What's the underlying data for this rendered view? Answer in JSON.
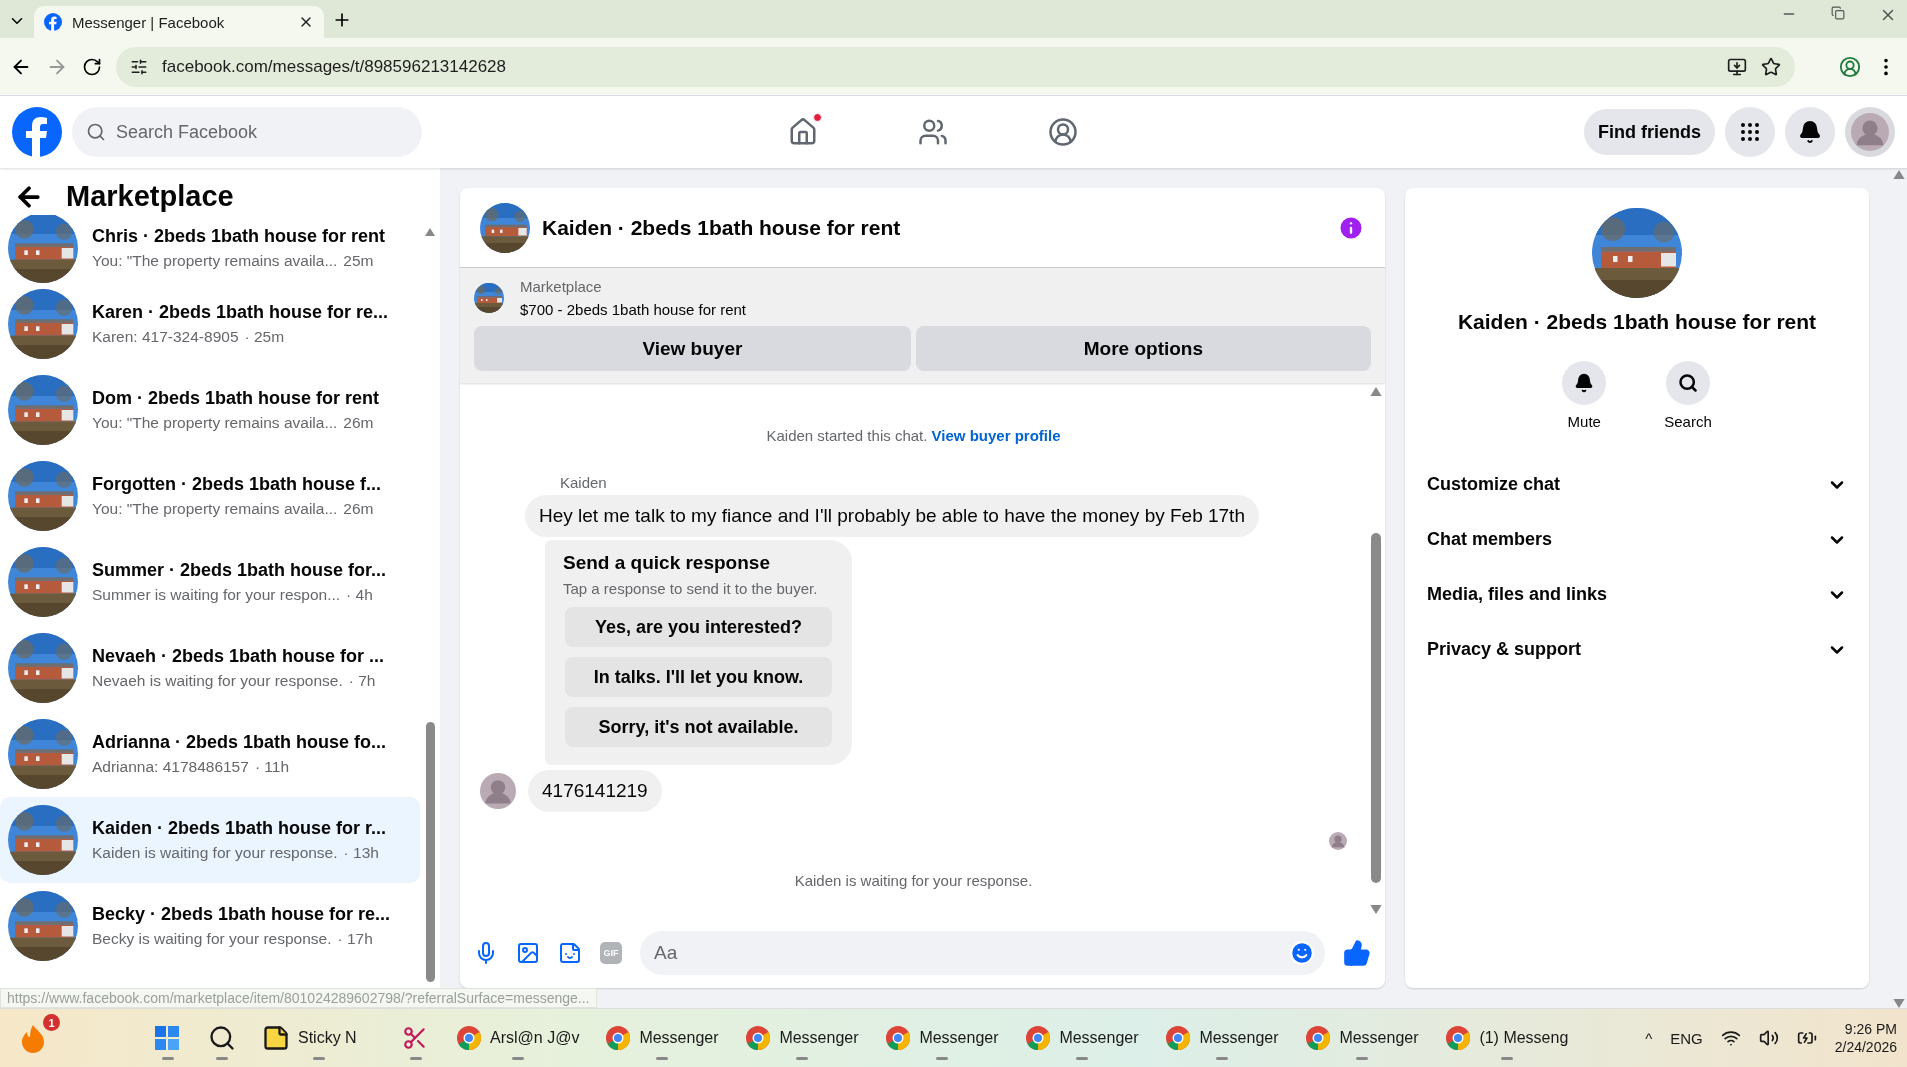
{
  "browser": {
    "tabs": [
      {
        "title": "Messenger | Facebook",
        "selected": true
      }
    ],
    "url": "facebook.com/messages/t/898596213142628"
  },
  "header": {
    "search_placeholder": "Search Facebook",
    "nav": [
      {
        "kind": "home",
        "notification": true
      },
      {
        "kind": "friends",
        "notification": false
      },
      {
        "kind": "groups",
        "notification": false
      }
    ],
    "find_friends": "Find friends"
  },
  "sidebar": {
    "title": "Marketplace",
    "conversations": [
      {
        "title": "Chris · 2beds 1bath house for rent",
        "preview": "You: \"The property remains availa...",
        "time": "25m",
        "selected": false
      },
      {
        "title": "Karen · 2beds 1bath house for re...",
        "preview": "Karen: 417-324-8905",
        "time": "· 25m",
        "selected": false
      },
      {
        "title": "Dom · 2beds 1bath house for rent",
        "preview": "You: \"The property remains availa...",
        "time": "26m",
        "selected": false
      },
      {
        "title": "Forgotten · 2beds 1bath house f...",
        "preview": "You: \"The property remains availa...",
        "time": "26m",
        "selected": false
      },
      {
        "title": "Summer · 2beds 1bath house for...",
        "preview": "Summer is waiting for your respon...",
        "time": "· 4h",
        "selected": false
      },
      {
        "title": "Nevaeh · 2beds 1bath house for ...",
        "preview": "Nevaeh is waiting for your response.",
        "time": "· 7h",
        "selected": false
      },
      {
        "title": "Adrianna · 2beds 1bath house fo...",
        "preview": "Adrianna: 4178486157",
        "time": "· 11h",
        "selected": false
      },
      {
        "title": "Kaiden · 2beds 1bath house for r...",
        "preview": "Kaiden is waiting for your response.",
        "time": "· 13h",
        "selected": true
      },
      {
        "title": "Becky · 2beds 1bath house for re...",
        "preview": "Becky is waiting for your response.",
        "time": "· 17h",
        "selected": false
      }
    ],
    "status_url": "https://www.facebook.com/marketplace/item/801024289602798/?referralSurface=messenge..."
  },
  "chat": {
    "title": "Kaiden · 2beds 1bath house for rent",
    "listing": {
      "label": "Marketplace",
      "price": "$700 - 2beds 1bath house for rent"
    },
    "buttons": [
      "View buyer",
      "More options"
    ],
    "started": "Kaiden started this chat.",
    "profile_link": "View buyer profile",
    "sender": "Kaiden",
    "message": "Hey let me talk to my fiance and I'll probably be able to have the money by Feb 17th",
    "quick_response": {
      "title": "Send a quick response",
      "subtitle": "Tap a response to send it to the buyer.",
      "options": [
        "Yes, are you interested?",
        "In talks. I'll let you know.",
        "Sorry, it's not available."
      ]
    },
    "phone_message": "4176141219",
    "waiting": "Kaiden is waiting for your response.",
    "composer_placeholder": "Aa",
    "gif_label": "GIF"
  },
  "details": {
    "name": "Kaiden · 2beds 1bath house for rent",
    "actions": [
      {
        "kind": "mute",
        "label": "Mute"
      },
      {
        "kind": "search",
        "label": "Search"
      }
    ],
    "sections": [
      "Customize chat",
      "Chat members",
      "Media, files and links",
      "Privacy & support"
    ]
  },
  "taskbar": {
    "badge": "1",
    "apps": [
      {
        "kind": "windows"
      },
      {
        "kind": "search"
      },
      {
        "kind": "sticky",
        "label": "Sticky N"
      },
      {
        "kind": "snip"
      },
      {
        "kind": "browser",
        "label": "Arsl@n J@v"
      },
      {
        "kind": "browser",
        "label": "Messenger"
      },
      {
        "kind": "browser",
        "label": "Messenger"
      },
      {
        "kind": "browser",
        "label": "Messenger"
      },
      {
        "kind": "browser",
        "label": "Messenger"
      },
      {
        "kind": "browser",
        "label": "Messenger"
      },
      {
        "kind": "browser",
        "label": "Messenger"
      },
      {
        "kind": "browser",
        "label": "(1) Messeng"
      }
    ],
    "tray": {
      "overflow": "^",
      "language": "ENG",
      "time": "9:26 PM",
      "date": "2/24/2026"
    }
  }
}
